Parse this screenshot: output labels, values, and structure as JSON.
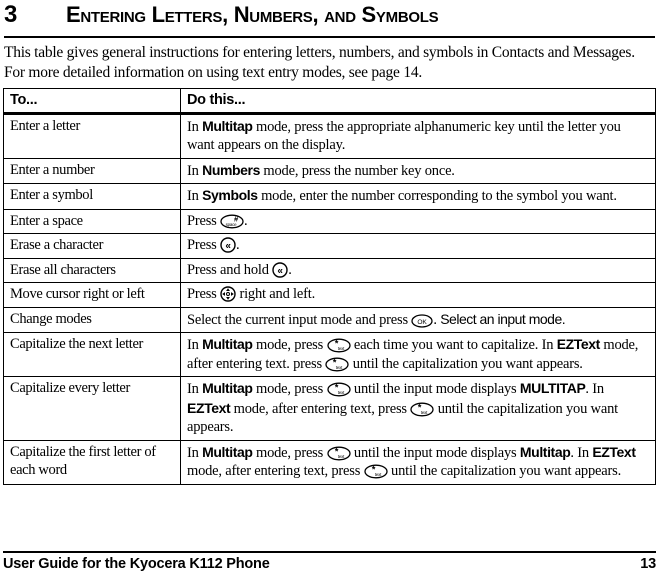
{
  "chapter": {
    "number": "3",
    "title": "Entering Letters, Numbers, and Symbols"
  },
  "intro": {
    "line1": "This table gives general instructions for entering letters, numbers, and symbols in Contacts and Messages.",
    "line2": "For more detailed information on using text entry modes, see page 14."
  },
  "table": {
    "headers": [
      "To...",
      "Do this..."
    ],
    "rows": [
      {
        "task": "Enter a letter",
        "action_pre": "In ",
        "action_mode": "Multitap",
        "action_post": " mode, press the appropriate alphanumeric key until the letter you want appears on the display.",
        "icon": ""
      },
      {
        "task": "Enter a number",
        "action_pre": "In ",
        "action_mode": "Numbers",
        "action_post": " mode, press the number key once.",
        "icon": ""
      },
      {
        "task": "Enter a symbol",
        "action_pre": "In ",
        "action_mode": "Symbols",
        "action_post": " mode, enter the number corresponding to the symbol you want.",
        "icon": ""
      },
      {
        "task": "Enter a space",
        "action_pre": "Press ",
        "action_mode": "",
        "action_post": ".",
        "icon": "space-key-icon"
      },
      {
        "task": "Erase a character",
        "action_pre": "Press ",
        "action_mode": "",
        "action_post": ".",
        "icon": "backspace-key-icon"
      },
      {
        "task": "Erase all characters",
        "action_pre": "Press and hold ",
        "action_mode": "",
        "action_post": ".",
        "icon": "backspace-key-icon"
      },
      {
        "task": "Move cursor right or left",
        "action_pre": "Press ",
        "action_mode": "",
        "action_post": " right and left.",
        "icon": "navigation-key-icon"
      },
      {
        "task": "Change modes",
        "action_pre": "Select the current input mode and press ",
        "action_mode": "",
        "action_post": ". ",
        "action_alt": "Select an input mode.",
        "icon": "ok-key-icon"
      },
      {
        "task": "Capitalize the next letter",
        "seg": [
          {
            "t": "In "
          },
          {
            "t": "Multitap",
            "bold": true
          },
          {
            "t": " mode, press "
          },
          {
            "icon": "star-text-key-icon"
          },
          {
            "t": " each time you want to capitalize. In "
          },
          {
            "t": "EZText",
            "bold": true
          },
          {
            "t": " mode, after entering text. press "
          },
          {
            "icon": "star-text-key-icon"
          },
          {
            "t": " until the capitalization you want appears."
          }
        ]
      },
      {
        "task": "Capitalize every letter",
        "seg": [
          {
            "t": "In "
          },
          {
            "t": "Multitap",
            "bold": true
          },
          {
            "t": " mode, press "
          },
          {
            "icon": "star-text-key-icon"
          },
          {
            "t": " until the input mode displays "
          },
          {
            "t": "MULTITAP",
            "bold": true
          },
          {
            "t": ". In "
          },
          {
            "t": "EZText",
            "bold": true
          },
          {
            "t": " mode, after entering text, press "
          },
          {
            "icon": "star-text-key-icon"
          },
          {
            "t": " until the capitalization you want appears."
          }
        ]
      },
      {
        "task": "Capitalize the first letter of each word",
        "seg": [
          {
            "t": "In "
          },
          {
            "t": "Multitap",
            "bold": true
          },
          {
            "t": " mode, press "
          },
          {
            "icon": "star-text-key-icon"
          },
          {
            "t": " until the input mode displays "
          },
          {
            "t": "Multitap",
            "bold": true
          },
          {
            "t": ". In "
          },
          {
            "t": "EZText",
            "bold": true
          },
          {
            "t": " mode, after entering text, press "
          },
          {
            "icon": "star-text-key-icon"
          },
          {
            "t": " until the capitalization you want appears."
          }
        ]
      }
    ]
  },
  "keys": {
    "space_symbol": "#",
    "space_label": "space",
    "star_symbol": "*",
    "star_label": "text",
    "backspace_symbol": "«",
    "ok_label": "OK"
  },
  "footer": {
    "left": "User Guide for the Kyocera K112 Phone",
    "page": "13"
  },
  "colors": {
    "ink": "#000000",
    "page": "#ffffff"
  }
}
